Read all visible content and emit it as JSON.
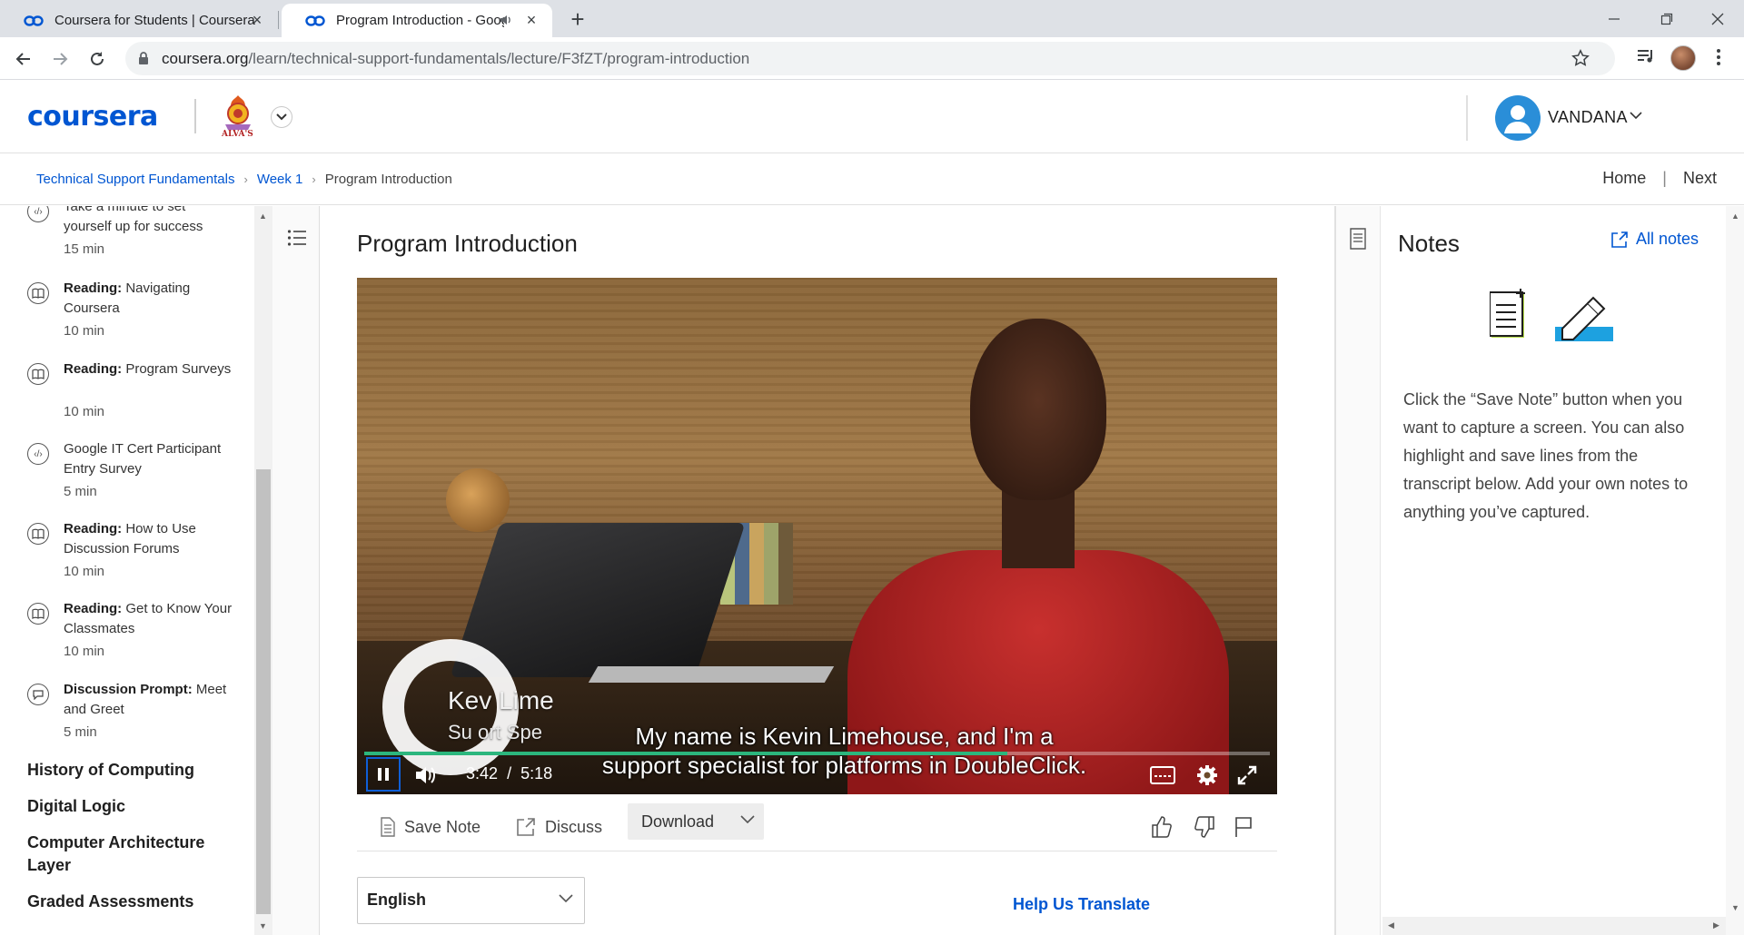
{
  "browser": {
    "tabs": [
      {
        "title": "Coursera for Students | Coursera"
      },
      {
        "title": "Program Introduction - Google IT Support"
      }
    ],
    "url_main": "coursera.org",
    "url_path": "/learn/technical-support-fundamentals/lecture/F3fZT/program-introduction"
  },
  "header": {
    "logo": "coursera",
    "org_label": "ALVA'S",
    "user_name": "VANDANA"
  },
  "breadcrumb": {
    "items": [
      "Technical Support Fundamentals",
      "Week 1"
    ],
    "current": "Program Introduction",
    "home": "Home",
    "next": "Next"
  },
  "syllabus": {
    "items": [
      {
        "prefix": "",
        "title": "Take a minute to set yourself up for success",
        "duration": "15 min",
        "icon": "code-icon"
      },
      {
        "prefix": "Reading:",
        "title": "Navigating Coursera",
        "duration": "10 min",
        "icon": "book-icon"
      },
      {
        "prefix": "Reading:",
        "title": "Program Surveys",
        "duration": "10 min",
        "icon": "book-icon"
      },
      {
        "prefix": "",
        "title": "Google IT Cert Participant Entry Survey",
        "duration": "5 min",
        "icon": "code-icon"
      },
      {
        "prefix": "Reading:",
        "title": "How to Use Discussion Forums",
        "duration": "10 min",
        "icon": "book-icon"
      },
      {
        "prefix": "Reading:",
        "title": "Get to Know Your Classmates",
        "duration": "10 min",
        "icon": "book-icon"
      },
      {
        "prefix": "Discussion Prompt:",
        "title": "Meet and Greet",
        "duration": "5 min",
        "icon": "chat-icon"
      }
    ],
    "sections": [
      "History of Computing",
      "Digital Logic",
      "Computer Architecture Layer",
      "Graded Assessments"
    ]
  },
  "main": {
    "title": "Program Introduction",
    "video": {
      "lower_third_name": "Kev    Lime",
      "lower_third_role": "Su   ort Spe",
      "caption_line1": "My name is Kevin Limehouse, and I'm a",
      "caption_line2": "support specialist for platforms in DoubleClick.",
      "current_time": "3:42",
      "time_sep": "/",
      "duration": "5:18",
      "progress": 0.71
    },
    "actions": {
      "save_note": "Save Note",
      "discuss": "Discuss",
      "download": "Download"
    },
    "language": "English",
    "help_translate": "Help Us Translate"
  },
  "notes": {
    "title": "Notes",
    "all_notes": "All notes",
    "description": "Click the “Save Note” button when you want to capture a screen. You can also highlight and save lines from the transcript below. Add your own notes to anything you’ve captured."
  },
  "colors": {
    "accent": "#0056d2",
    "progress": "#2cb67d"
  }
}
